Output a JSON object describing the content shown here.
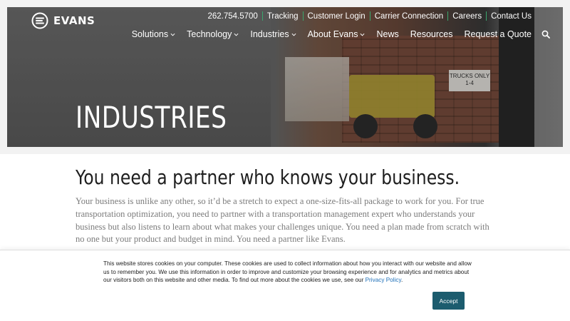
{
  "brand": {
    "name": "EVANS",
    "accent": "#3aa76d"
  },
  "utility_nav": [
    "262.754.5700",
    "Tracking",
    "Customer Login",
    "Carrier Connection",
    "Careers",
    "Contact Us"
  ],
  "main_nav": [
    {
      "label": "Solutions",
      "has_dropdown": true
    },
    {
      "label": "Technology",
      "has_dropdown": true
    },
    {
      "label": "Industries",
      "has_dropdown": true
    },
    {
      "label": "About Evans",
      "has_dropdown": true
    },
    {
      "label": "News",
      "has_dropdown": false
    },
    {
      "label": "Resources",
      "has_dropdown": false
    },
    {
      "label": "Request a Quote",
      "has_dropdown": false
    }
  ],
  "search_icon": "search-icon",
  "hero": {
    "title": "INDUSTRIES",
    "sign_text": "TRUCKS ONLY 1-4"
  },
  "content": {
    "heading": "You need a partner who knows your business.",
    "body": "Your business is unlike any other, so it’d be a stretch to expect a one-size-fits-all package to work for you. For true transportation optimization, you need to partner with a transportation management expert who understands your business but also listens to learn about what makes your challenges unique. You need a plan made from scratch with no one but your product and budget in mind. You need a partner like Evans."
  },
  "cookie": {
    "text": "This website stores cookies on your computer. These cookies are used to collect information about how you interact with our website and allow us to remember you. We use this information in order to improve and customize your browsing experience and for analytics and metrics about our visitors both on this website and other media. To find out more about the cookies we use, see our ",
    "link_label": "Privacy Policy",
    "after_link": ".",
    "accept_label": "Accept"
  }
}
